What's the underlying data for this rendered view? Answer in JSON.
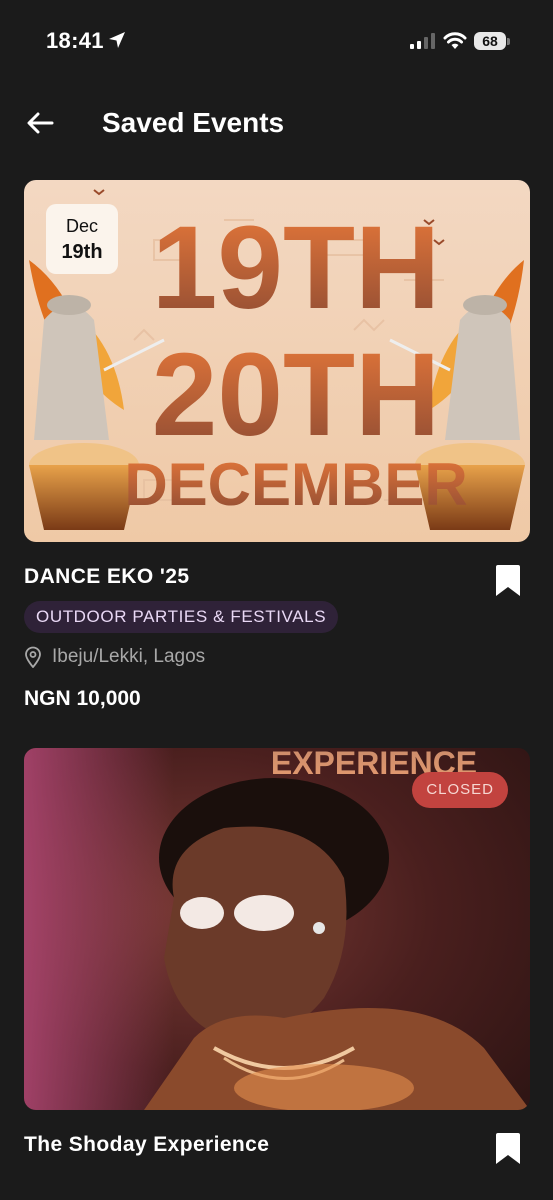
{
  "status_bar": {
    "time": "18:41",
    "battery": "68"
  },
  "header": {
    "title": "Saved Events"
  },
  "events": [
    {
      "title": "DANCE EKO '25",
      "date_month": "Dec",
      "date_day": "19th",
      "category": "OUTDOOR PARTIES & FESTIVALS",
      "location": "Ibeju/Lekki, Lagos",
      "price": "NGN 10,000",
      "poster_lines": [
        "19TH",
        "20TH",
        "DECEMBER"
      ],
      "bookmarked": true
    },
    {
      "title": "The Shoday Experience",
      "status": "CLOSED",
      "poster_text": "EXPERIENCE",
      "bookmarked": true
    }
  ]
}
